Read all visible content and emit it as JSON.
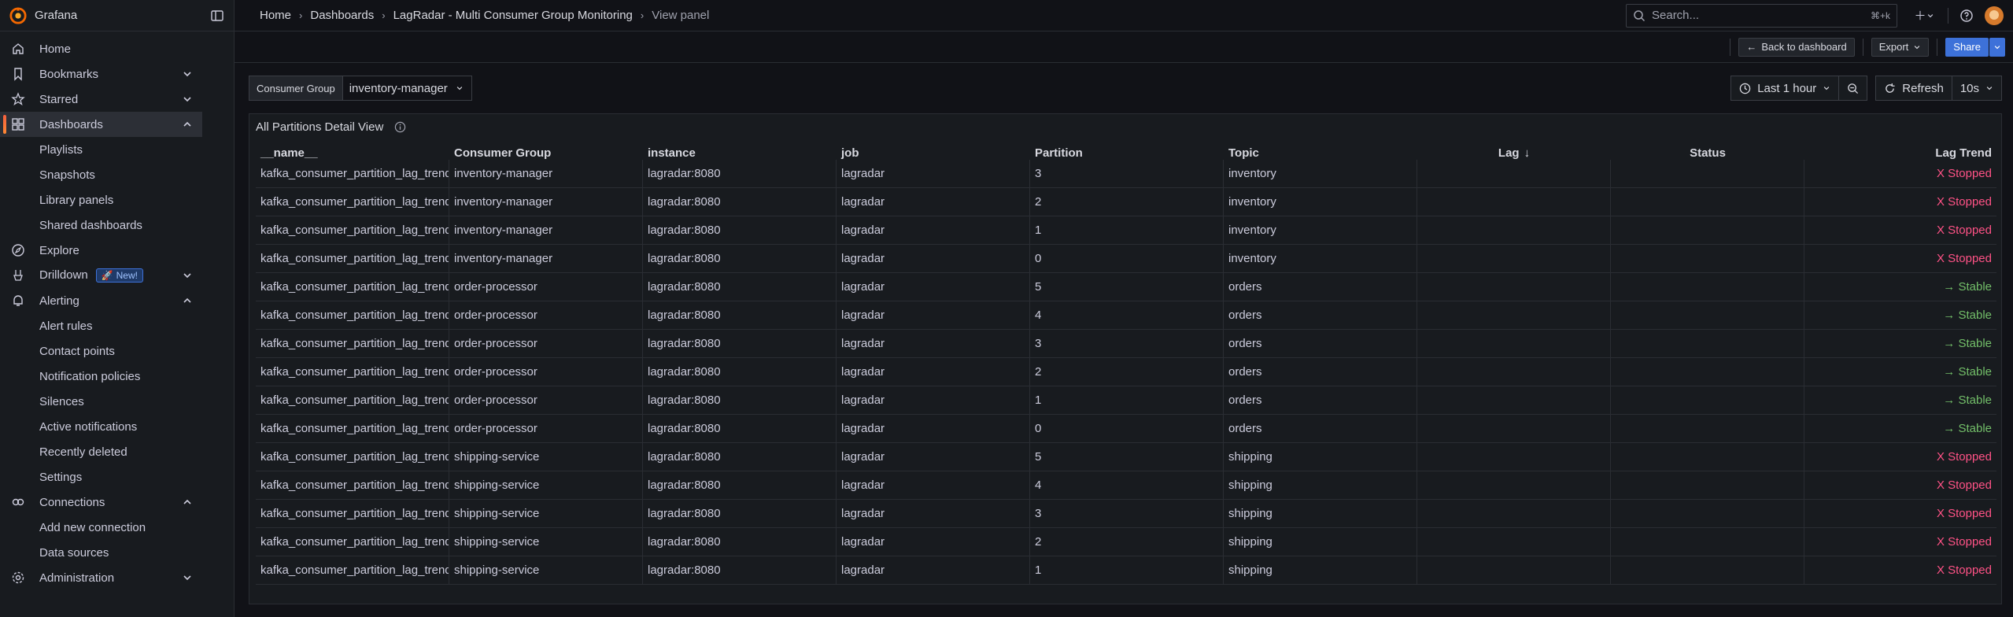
{
  "app": {
    "name": "Grafana"
  },
  "sidebar": {
    "items": [
      {
        "label": "Home",
        "icon": "home-icon"
      },
      {
        "label": "Bookmarks",
        "icon": "bookmark-icon",
        "expand": "down"
      },
      {
        "label": "Starred",
        "icon": "star-icon",
        "expand": "down"
      },
      {
        "label": "Dashboards",
        "icon": "dashboards-icon",
        "expand": "up",
        "active": true
      },
      {
        "label": "Explore",
        "icon": "explore-icon"
      },
      {
        "label": "Drilldown",
        "icon": "drilldown-icon",
        "expand": "down",
        "badge": "New!"
      },
      {
        "label": "Alerting",
        "icon": "bell-icon",
        "expand": "up"
      },
      {
        "label": "Connections",
        "icon": "connections-icon",
        "expand": "up"
      },
      {
        "label": "Administration",
        "icon": "gear-icon",
        "expand": "down"
      }
    ],
    "dashboards_children": [
      "Playlists",
      "Snapshots",
      "Library panels",
      "Shared dashboards"
    ],
    "alerting_children": [
      "Alert rules",
      "Contact points",
      "Notification policies",
      "Silences",
      "Active notifications",
      "Recently deleted",
      "Settings"
    ],
    "connections_children": [
      "Add new connection",
      "Data sources"
    ]
  },
  "breadcrumbs": [
    "Home",
    "Dashboards",
    "LagRadar - Multi Consumer Group Monitoring",
    "View panel"
  ],
  "search": {
    "placeholder": "Search...",
    "shortcut": "⌘+k"
  },
  "toolbar": {
    "back_label": "Back to dashboard",
    "export_label": "Export",
    "share_label": "Share"
  },
  "variables": {
    "label": "Consumer Group",
    "value": "inventory-manager"
  },
  "time": {
    "range": "Last 1 hour",
    "refresh_label": "Refresh",
    "refresh_interval": "10s"
  },
  "panel": {
    "title": "All Partitions Detail View",
    "columns": [
      "__name__",
      "Consumer Group",
      "instance",
      "job",
      "Partition",
      "Topic",
      "Lag",
      "Status",
      "Lag Trend"
    ],
    "rows": [
      [
        "kafka_consumer_partition_lag_trend",
        "inventory-manager",
        "lagradar:8080",
        "lagradar",
        "3",
        "inventory",
        "",
        "",
        "X Stopped"
      ],
      [
        "kafka_consumer_partition_lag_trend",
        "inventory-manager",
        "lagradar:8080",
        "lagradar",
        "2",
        "inventory",
        "",
        "",
        "X Stopped"
      ],
      [
        "kafka_consumer_partition_lag_trend",
        "inventory-manager",
        "lagradar:8080",
        "lagradar",
        "1",
        "inventory",
        "",
        "",
        "X Stopped"
      ],
      [
        "kafka_consumer_partition_lag_trend",
        "inventory-manager",
        "lagradar:8080",
        "lagradar",
        "0",
        "inventory",
        "",
        "",
        "X Stopped"
      ],
      [
        "kafka_consumer_partition_lag_trend",
        "order-processor",
        "lagradar:8080",
        "lagradar",
        "5",
        "orders",
        "",
        "",
        "→ Stable"
      ],
      [
        "kafka_consumer_partition_lag_trend",
        "order-processor",
        "lagradar:8080",
        "lagradar",
        "4",
        "orders",
        "",
        "",
        "→ Stable"
      ],
      [
        "kafka_consumer_partition_lag_trend",
        "order-processor",
        "lagradar:8080",
        "lagradar",
        "3",
        "orders",
        "",
        "",
        "→ Stable"
      ],
      [
        "kafka_consumer_partition_lag_trend",
        "order-processor",
        "lagradar:8080",
        "lagradar",
        "2",
        "orders",
        "",
        "",
        "→ Stable"
      ],
      [
        "kafka_consumer_partition_lag_trend",
        "order-processor",
        "lagradar:8080",
        "lagradar",
        "1",
        "orders",
        "",
        "",
        "→ Stable"
      ],
      [
        "kafka_consumer_partition_lag_trend",
        "order-processor",
        "lagradar:8080",
        "lagradar",
        "0",
        "orders",
        "",
        "",
        "→ Stable"
      ],
      [
        "kafka_consumer_partition_lag_trend",
        "shipping-service",
        "lagradar:8080",
        "lagradar",
        "5",
        "shipping",
        "",
        "",
        "X Stopped"
      ],
      [
        "kafka_consumer_partition_lag_trend",
        "shipping-service",
        "lagradar:8080",
        "lagradar",
        "4",
        "shipping",
        "",
        "",
        "X Stopped"
      ],
      [
        "kafka_consumer_partition_lag_trend",
        "shipping-service",
        "lagradar:8080",
        "lagradar",
        "3",
        "shipping",
        "",
        "",
        "X Stopped"
      ],
      [
        "kafka_consumer_partition_lag_trend",
        "shipping-service",
        "lagradar:8080",
        "lagradar",
        "2",
        "shipping",
        "",
        "",
        "X Stopped"
      ],
      [
        "kafka_consumer_partition_lag_trend",
        "shipping-service",
        "lagradar:8080",
        "lagradar",
        "1",
        "shipping",
        "",
        "",
        "X Stopped"
      ]
    ]
  },
  "colors": {
    "accent": "#3d71d9",
    "stopped": "#ff5286",
    "stable": "#73bf69",
    "brand_orange": "#f55f3e"
  }
}
